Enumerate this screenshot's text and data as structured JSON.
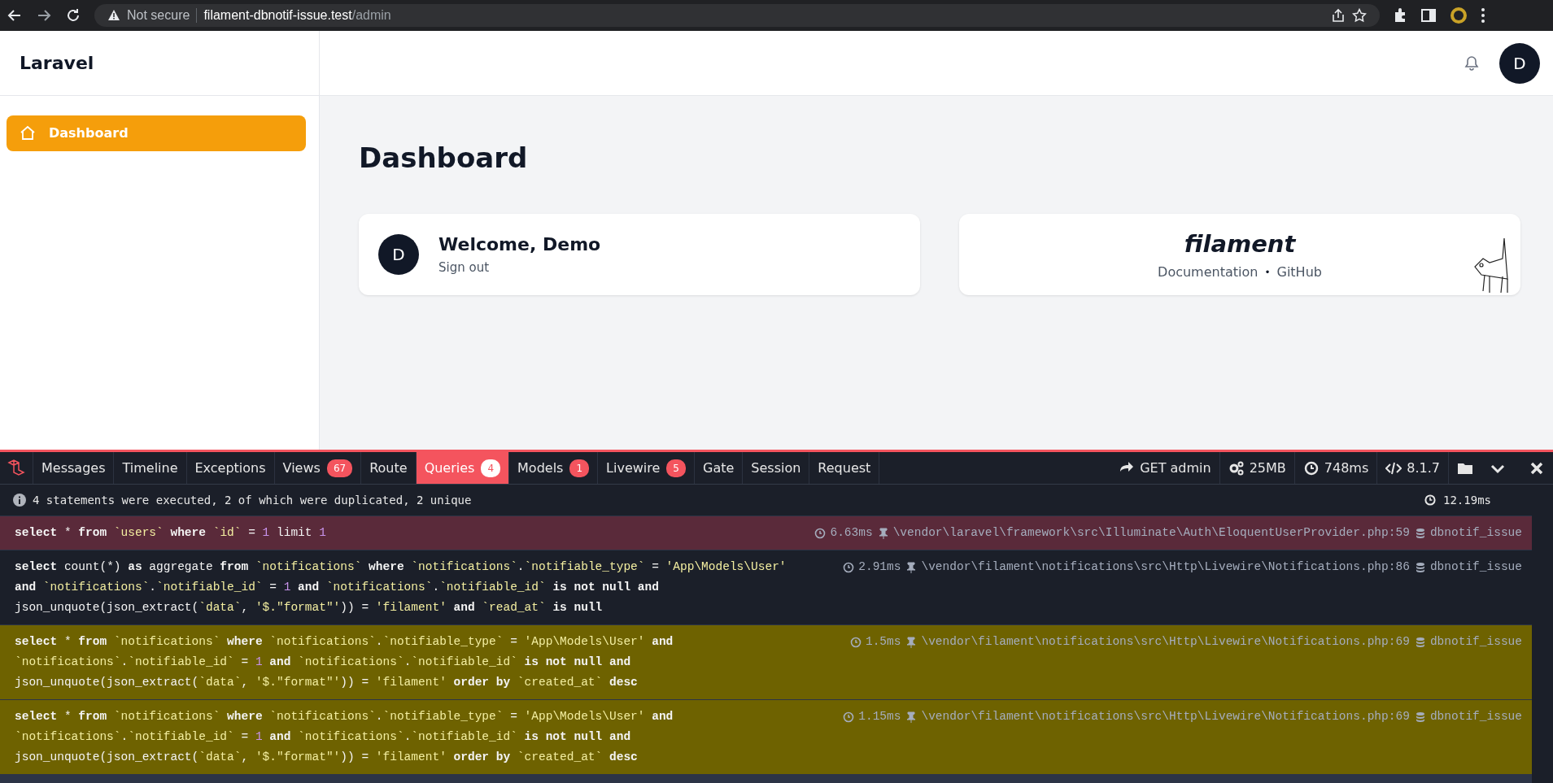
{
  "browser": {
    "security": "Not secure",
    "host": "filament-dbnotif-issue.test",
    "path": "/admin"
  },
  "app": {
    "brand": "Laravel",
    "avatar": "D"
  },
  "sidebar": {
    "items": [
      {
        "label": "Dashboard",
        "selected": true
      }
    ]
  },
  "page": {
    "title": "Dashboard",
    "welcome": {
      "avatar": "D",
      "heading": "Welcome, Demo",
      "action": "Sign out"
    },
    "filament": {
      "logo": "filament",
      "links": [
        "Documentation",
        "GitHub"
      ],
      "separator": "•"
    }
  },
  "debugbar": {
    "tabs": [
      {
        "label": "Messages",
        "selected": false
      },
      {
        "label": "Timeline",
        "selected": false
      },
      {
        "label": "Exceptions",
        "selected": false
      },
      {
        "label": "Views",
        "count": "67",
        "selected": false
      },
      {
        "label": "Route",
        "selected": false
      },
      {
        "label": "Queries",
        "count": "4",
        "selected": true
      },
      {
        "label": "Models",
        "count": "1",
        "selected": false
      },
      {
        "label": "Livewire",
        "count": "5",
        "selected": false
      },
      {
        "label": "Gate",
        "selected": false
      },
      {
        "label": "Session",
        "selected": false
      },
      {
        "label": "Request",
        "selected": false
      }
    ],
    "indicators": [
      {
        "kind": "request",
        "text": "GET admin"
      },
      {
        "kind": "memory",
        "text": "25MB"
      },
      {
        "kind": "time",
        "text": "748ms"
      },
      {
        "kind": "php",
        "text": "8.1.7"
      }
    ],
    "summary": "4 statements were executed, 2 of which were duplicated, 2 unique",
    "total_time": "12.19ms",
    "queries": [
      {
        "selected": true,
        "duplicated": false,
        "time": "6.63ms",
        "source": "\\vendor\\laravel\\framework\\src\\Illuminate\\Auth\\EloquentUserProvider.php:59",
        "connection": "dbnotif_issue",
        "lines": [
          "**select** * **from** `users` **where** `id` = 1 limit 1"
        ]
      },
      {
        "selected": false,
        "duplicated": false,
        "time": "2.91ms",
        "source": "\\vendor\\filament\\notifications\\src\\Http\\Livewire\\Notifications.php:86",
        "connection": "dbnotif_issue",
        "lines": [
          "**select** count(*) **as** aggregate **from** `notifications` **where** `notifications`.`notifiable_type` = 'App\\Models\\User'",
          "**and** `notifications`.`notifiable_id` = 1 **and** `notifications`.`notifiable_id` **is not null and**",
          "json_unquote(json_extract(`data`, '$.\"format\"')) = 'filament' **and** `read_at` **is null**"
        ]
      },
      {
        "selected": false,
        "duplicated": true,
        "time": "1.5ms",
        "source": "\\vendor\\filament\\notifications\\src\\Http\\Livewire\\Notifications.php:69",
        "connection": "dbnotif_issue",
        "lines": [
          "**select** * **from** `notifications` **where** `notifications`.`notifiable_type` = 'App\\Models\\User' **and**",
          "`notifications`.`notifiable_id` = 1 **and** `notifications`.`notifiable_id` **is not null and**",
          "json_unquote(json_extract(`data`, '$.\"format\"')) = 'filament' **order by** `created_at` **desc**"
        ]
      },
      {
        "selected": false,
        "duplicated": true,
        "time": "1.15ms",
        "source": "\\vendor\\filament\\notifications\\src\\Http\\Livewire\\Notifications.php:69",
        "connection": "dbnotif_issue",
        "lines": [
          "**select** * **from** `notifications` **where** `notifications`.`notifiable_type` = 'App\\Models\\User' **and**",
          "`notifications`.`notifiable_id` = 1 **and** `notifications`.`notifiable_id` **is not null and**",
          "json_unquote(json_extract(`data`, '$.\"format\"')) = 'filament' **order by** `created_at` **desc**"
        ]
      }
    ]
  }
}
